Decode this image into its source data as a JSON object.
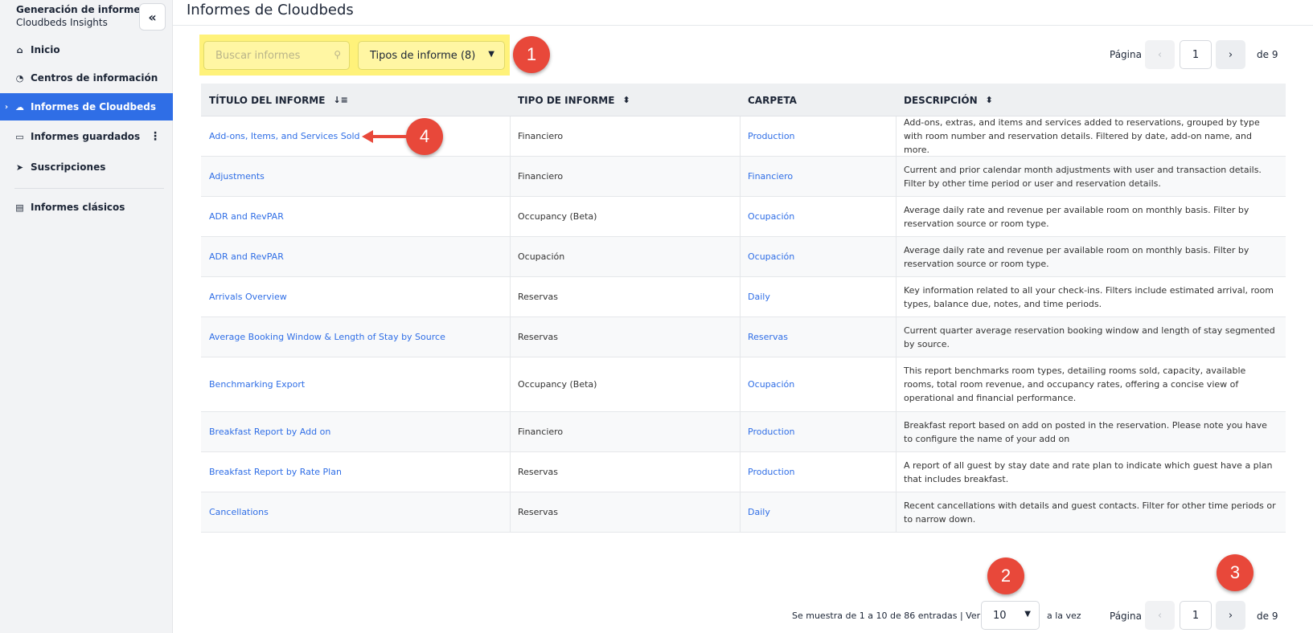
{
  "sidebar": {
    "title": "Generación de informes",
    "subtitle": "Cloudbeds Insights",
    "collapse_icon": "«",
    "items": [
      {
        "label": "Inicio",
        "icon": "home-icon",
        "glyph": "⌂"
      },
      {
        "label": "Centros de información",
        "icon": "dashboard-icon",
        "glyph": "◔"
      },
      {
        "label": "Informes de Cloudbeds",
        "icon": "cloud-icon",
        "glyph": "☁"
      },
      {
        "label": "Informes guardados",
        "icon": "saved-icon",
        "glyph": "▭"
      },
      {
        "label": "Suscripciones",
        "icon": "send-icon",
        "glyph": "➤"
      },
      {
        "label": "Informes clásicos",
        "icon": "archive-icon",
        "glyph": "▤"
      }
    ],
    "active_index": 2,
    "active_color": "#2f6ee6"
  },
  "header": {
    "title": "Informes de Cloudbeds"
  },
  "filters": {
    "search_placeholder": "Buscar informes",
    "report_types_label": "Tipos de informe (8)",
    "highlight_color": "#fff27a"
  },
  "pagination": {
    "page_label": "Página",
    "current_page": "1",
    "total_label": "de 9",
    "prev_glyph": "‹",
    "next_glyph": "›"
  },
  "markers": [
    "1",
    "2",
    "3",
    "4"
  ],
  "table": {
    "columns": [
      {
        "label": "TÍTULO DEL INFORME",
        "sort_glyph": "↓≡"
      },
      {
        "label": "TIPO DE INFORME",
        "sort_glyph": "⬍"
      },
      {
        "label": "CARPETA",
        "sort_glyph": ""
      },
      {
        "label": "DESCRIPCIÓN",
        "sort_glyph": "⬍"
      }
    ],
    "rows": [
      {
        "title": "Add-ons, Items, and Services Sold",
        "type": "Financiero",
        "folder": "Production",
        "desc": "Add-ons, extras, and items and services added to reservations, grouped by type with room number and reservation details. Filtered by date, add-on name, and more."
      },
      {
        "title": "Adjustments",
        "type": "Financiero",
        "folder": "Financiero",
        "desc": "Current and prior calendar month adjustments with user and transaction details. Filter by other time period or user and reservation details."
      },
      {
        "title": "ADR and RevPAR",
        "type": "Occupancy (Beta)",
        "folder": "Ocupación",
        "desc": "Average daily rate and revenue per available room on monthly basis. Filter by reservation source or room type."
      },
      {
        "title": "ADR and RevPAR",
        "type": "Ocupación",
        "folder": "Ocupación",
        "desc": "Average daily rate and revenue per available room on monthly basis. Filter by reservation source or room type."
      },
      {
        "title": "Arrivals Overview",
        "type": "Reservas",
        "folder": "Daily",
        "desc": "Key information related to all your check-ins. Filters include estimated arrival, room types, balance due, notes, and time periods."
      },
      {
        "title": "Average Booking Window & Length of Stay by Source",
        "type": "Reservas",
        "folder": "Reservas",
        "desc": "Current quarter average reservation booking window and length of stay segmented by source."
      },
      {
        "title": "Benchmarking Export",
        "type": "Occupancy (Beta)",
        "folder": "Ocupación",
        "desc": "This report benchmarks room types, detailing rooms sold, capacity, available rooms, total room revenue, and occupancy rates, offering a concise view of operational and financial performance."
      },
      {
        "title": "Breakfast Report by Add on",
        "type": "Financiero",
        "folder": "Production",
        "desc": "Breakfast report based on add on posted in the reservation. Please note you have to configure the name of your add on"
      },
      {
        "title": "Breakfast Report by Rate Plan",
        "type": "Reservas",
        "folder": "Production",
        "desc": "A report of all guest by stay date and rate plan to indicate which guest have a plan that includes breakfast."
      },
      {
        "title": "Cancellations",
        "type": "Reservas",
        "folder": "Daily",
        "desc": "Recent cancellations with details and guest contacts. Filter for other time periods or to narrow down."
      }
    ]
  },
  "footer": {
    "showing_text": "Se muestra de 1 a 10 de 86 entradas | Ver",
    "per_page_value": "10",
    "after_text": "a la vez"
  }
}
